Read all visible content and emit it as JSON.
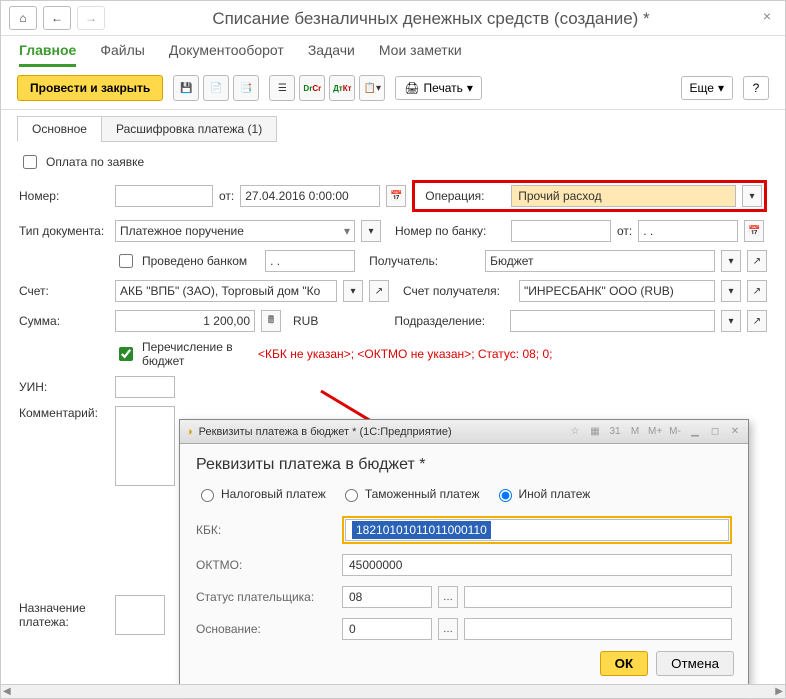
{
  "header": {
    "title": "Списание безналичных денежных средств (создание) *"
  },
  "tabs": {
    "items": [
      "Главное",
      "Файлы",
      "Документооборот",
      "Задачи",
      "Мои заметки"
    ],
    "active": 0
  },
  "toolbar": {
    "post_close": "Провести и закрыть",
    "print": "Печать",
    "more": "Еще",
    "help": "?"
  },
  "subtabs": {
    "main": "Основное",
    "details": "Расшифровка платежа (1)"
  },
  "form": {
    "pay_request": "Оплата по заявке",
    "number_lbl": "Номер:",
    "number_val": "",
    "from_lbl": "от:",
    "date_val": "27.04.2016  0:00:00",
    "operation_lbl": "Операция:",
    "operation_val": "Прочий расход",
    "doctype_lbl": "Тип документа:",
    "doctype_val": "Платежное поручение",
    "bank_number_lbl": "Номер по банку:",
    "bank_number_val": "",
    "bank_from_lbl": "от:",
    "bank_date_val": ". .",
    "bank_posted": "Проведено банком",
    "bank_posted_date": ". .",
    "recipient_lbl": "Получатель:",
    "recipient_val": "Бюджет",
    "account_lbl": "Счет:",
    "account_val": "АКБ \"ВПБ\" (ЗАО), Торговый дом \"Ко",
    "recipient_acc_lbl": "Счет получателя:",
    "recipient_acc_val": "\"ИНРЕСБАНК\" ООО (RUB)",
    "sum_lbl": "Сумма:",
    "sum_val": "1 200,00",
    "currency": "RUB",
    "division_lbl": "Подразделение:",
    "division_val": "",
    "to_budget": "Перечисление в бюджет",
    "budget_warn": "<КБК не указан>; <ОКТМО не указан>; Статус: 08; 0;",
    "uin_lbl": "УИН:",
    "comment_lbl": "Комментарий:",
    "purpose_lbl": "Назначение платежа:"
  },
  "dialog": {
    "titlebar": "Реквизиты платежа в бюджет *  (1С:Предприятие)",
    "heading": "Реквизиты платежа в бюджет *",
    "r1": "Налоговый платеж",
    "r2": "Таможенный платеж",
    "r3": "Иной платеж",
    "kbk_lbl": "КБК:",
    "kbk_val": "18210101011011000110",
    "oktmo_lbl": "ОКТМО:",
    "oktmo_val": "45000000",
    "status_lbl": "Статус плательщика:",
    "status_val": "08",
    "basis_lbl": "Основание:",
    "basis_val": "0",
    "ok": "ОК",
    "cancel": "Отмена"
  }
}
